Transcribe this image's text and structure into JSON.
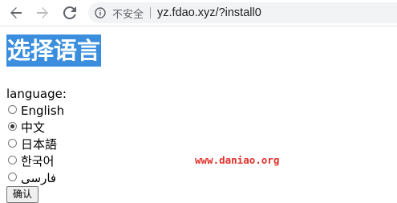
{
  "browser": {
    "security_label": "不安全",
    "url": "yz.fdao.xyz/?install0",
    "icons": [
      "back-arrow-icon",
      "forward-arrow-icon",
      "reload-icon",
      "info-icon"
    ]
  },
  "page": {
    "title": "选择语言",
    "language_label": "language:",
    "options": [
      {
        "label": "English",
        "checked": false
      },
      {
        "label": "中文",
        "checked": true
      },
      {
        "label": "日本語",
        "checked": false
      },
      {
        "label": "한국어",
        "checked": false
      },
      {
        "label": "فارسی",
        "checked": false
      }
    ],
    "confirm_button": "确认",
    "watermark": "www.daniao.org"
  },
  "colors": {
    "title_background": "#3b8edd",
    "watermark": "#e0302a",
    "omnibox": "#f1f3f4"
  }
}
